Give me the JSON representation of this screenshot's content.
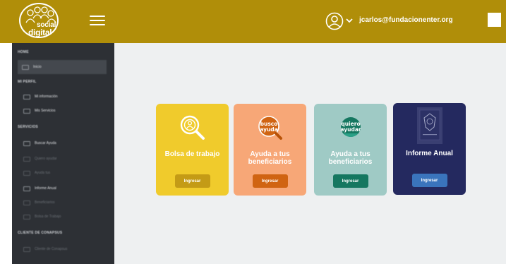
{
  "header": {
    "logo_line1": "social",
    "logo_line2": "digital",
    "user_email": "jcarlos@fundacionenter.org"
  },
  "sidebar": {
    "sections": [
      {
        "label": "HOME"
      },
      {
        "label": "MI PERFIL"
      },
      {
        "label": "SERVICIOS"
      },
      {
        "label": "CLIENTE DE CONAPSUS"
      }
    ],
    "items": [
      {
        "label": "Inicio"
      },
      {
        "label": "Mi información"
      },
      {
        "label": "Mis Servicios"
      },
      {
        "label": "Buscar Ayuda"
      },
      {
        "label": "Quiero ayudar"
      },
      {
        "label": "Ayuda tus"
      },
      {
        "label": "Informe Anual"
      },
      {
        "label": "Beneficiarios"
      },
      {
        "label": "Bolsa de Trabajo"
      },
      {
        "label": "Cliente de Conapsus"
      }
    ]
  },
  "cards": [
    {
      "title": "Bolsa de trabajo",
      "button": "Ingresar",
      "bg": "#f0cb2c",
      "btn_bg": "#c49b16",
      "icon_text": ""
    },
    {
      "title": "Ayuda a tus beneficiarios",
      "button": "Ingresar",
      "bg": "#f7a777",
      "btn_bg": "#d06412",
      "icon_text_1": "busco",
      "icon_text_2": "ayuda"
    },
    {
      "title": "Ayuda a tus beneficiarios",
      "button": "Ingresar",
      "bg": "#9fcac5",
      "btn_bg": "#157760",
      "icon_text_1": "quiero",
      "icon_text_2": "ayudar"
    },
    {
      "title": "Informe Anual",
      "button": "Ingresar",
      "bg": "#24295f",
      "btn_bg": "#3a74bc"
    }
  ]
}
